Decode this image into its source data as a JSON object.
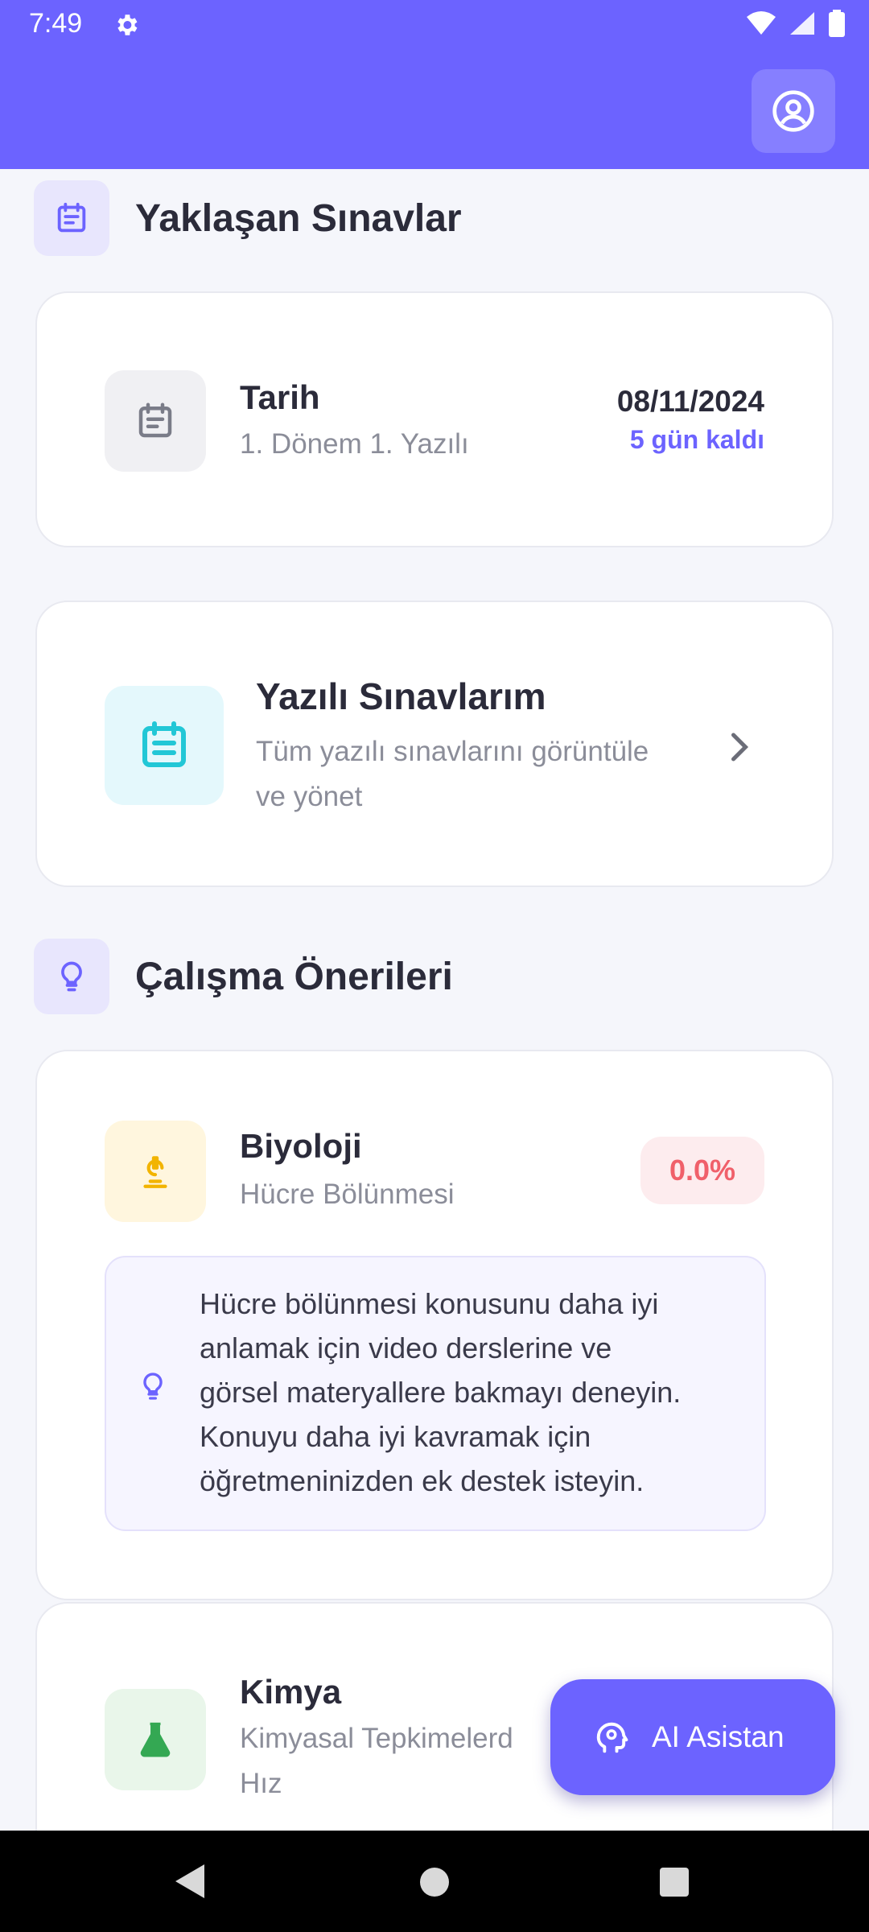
{
  "status": {
    "time": "7:49"
  },
  "sections": {
    "exams_title": "Yaklaşan Sınavlar",
    "study_title": "Çalışma Önerileri"
  },
  "exam_card": {
    "title": "Tarih",
    "subtitle": "1. Dönem 1. Yazılı",
    "date": "08/11/2024",
    "days_left": "5 gün kaldı"
  },
  "written_exams": {
    "title": "Yazılı Sınavlarım",
    "desc_line1": "Tüm yazılı sınavlarını görüntüle",
    "desc_line2": "ve yönet"
  },
  "recommendations": [
    {
      "subject": "Biyoloji",
      "topic": "Hücre Bölünmesi",
      "score": "0.0%",
      "advice_lines": [
        "Hücre bölünmesi konusunu daha iyi",
        "anlamak için video derslerine ve",
        "görsel materyallere bakmayı deneyin.",
        "Konuyu daha iyi kavramak için",
        "öğretmeninizden ek destek isteyin."
      ]
    },
    {
      "subject": "Kimya",
      "topic_line1": "Kimyasal Tepkimelerd",
      "topic_line2": "Hız"
    }
  ],
  "fab": {
    "label": "AI Asistan"
  },
  "colors": {
    "primary": "#6c63ff",
    "danger": "#f0606a"
  },
  "icons": {
    "profile": "account-circle-icon",
    "calendar": "calendar-icon",
    "bulb": "lightbulb-icon",
    "microscope": "microscope-icon",
    "flask": "flask-icon",
    "brain": "brain-icon",
    "chevron": "chevron-right-icon"
  }
}
